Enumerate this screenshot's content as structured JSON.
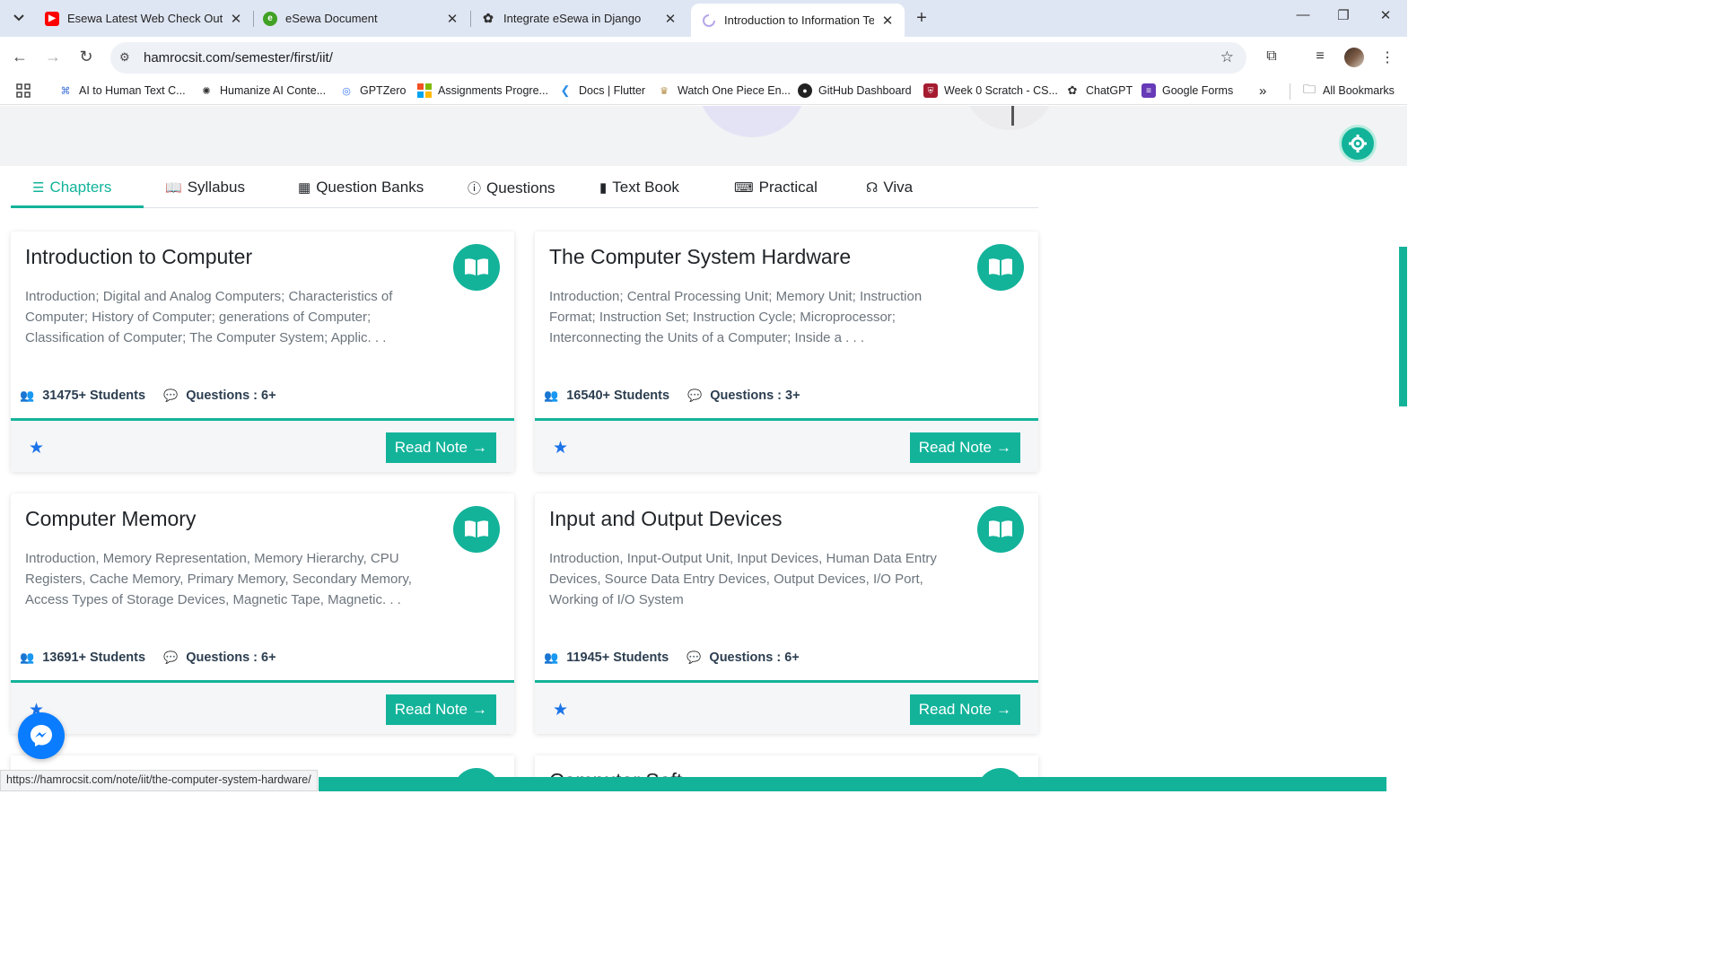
{
  "browser": {
    "tabs": [
      {
        "title": "Esewa Latest Web Check Out Ap",
        "favicon": "youtube-icon",
        "color": "#ff0000"
      },
      {
        "title": "eSewa Document",
        "favicon": "esewa-icon",
        "color": "#41a124"
      },
      {
        "title": "Integrate eSewa in Django",
        "favicon": "openai-icon",
        "color": "#333333"
      },
      {
        "title": "Introduction to Information Tec",
        "favicon": "loading-icon",
        "color": "#b7a6e8",
        "active": true
      }
    ],
    "url": "hamrocsit.com/semester/first/iit/",
    "bookmarks": [
      {
        "label": "AI to Human Text C..."
      },
      {
        "label": "Humanize AI Conte..."
      },
      {
        "label": "GPTZero"
      },
      {
        "label": "Assignments Progre..."
      },
      {
        "label": "Docs | Flutter"
      },
      {
        "label": "Watch One Piece En..."
      },
      {
        "label": "GitHub Dashboard"
      },
      {
        "label": "Week 0 Scratch - CS..."
      },
      {
        "label": "ChatGPT"
      },
      {
        "label": "Google Forms"
      }
    ],
    "all_bookmarks": "All Bookmarks",
    "status_url": "https://hamrocsit.com/note/iit/the-computer-system-hardware/"
  },
  "nav_tabs": [
    {
      "label": "Chapters",
      "icon": "list-icon",
      "active": true
    },
    {
      "label": "Syllabus",
      "icon": "book-reader-icon"
    },
    {
      "label": "Question Banks",
      "icon": "table-icon"
    },
    {
      "label": "Questions",
      "icon": "question-circle-icon"
    },
    {
      "label": "Text Book",
      "icon": "book-icon"
    },
    {
      "label": "Practical",
      "icon": "laptop-code-icon"
    },
    {
      "label": "Viva",
      "icon": "headset-icon"
    }
  ],
  "cards": [
    {
      "title": "Introduction to Computer",
      "description": "Introduction; Digital and Analog Computers; Characteristics of Computer; History of Computer; generations of Computer; Classification of Computer; The Computer System; Applic. . .",
      "students": "31475+ Students",
      "questions": "Questions : 6+",
      "button": "Read Note"
    },
    {
      "title": "The Computer System Hardware",
      "description": "Introduction; Central Processing Unit; Memory Unit; Instruction Format; Instruction Set; Instruction Cycle; Microprocessor; Interconnecting the Units of a Computer; Inside a . . .",
      "students": "16540+ Students",
      "questions": "Questions : 3+",
      "button": "Read Note"
    },
    {
      "title": "Computer Memory",
      "description": "Introduction, Memory Representation, Memory Hierarchy, CPU Registers, Cache Memory, Primary Memory, Secondary Memory, Access Types of Storage Devices, Magnetic Tape, Magnetic. . .",
      "students": "13691+ Students",
      "questions": "Questions : 6+",
      "button": "Read Note"
    },
    {
      "title": "Input and Output Devices",
      "description": "Introduction, Input-Output Unit, Input Devices, Human Data Entry Devices, Source Data Entry Devices, Output Devices, I/O Port, Working of I/O System",
      "students": "11945+ Students",
      "questions": "Questions : 6+",
      "button": "Read Note"
    }
  ],
  "partial_card_title": "Computer Soft",
  "colors": {
    "accent": "#13b39a",
    "star": "#1a73e8",
    "messenger": "#0a7cff"
  }
}
